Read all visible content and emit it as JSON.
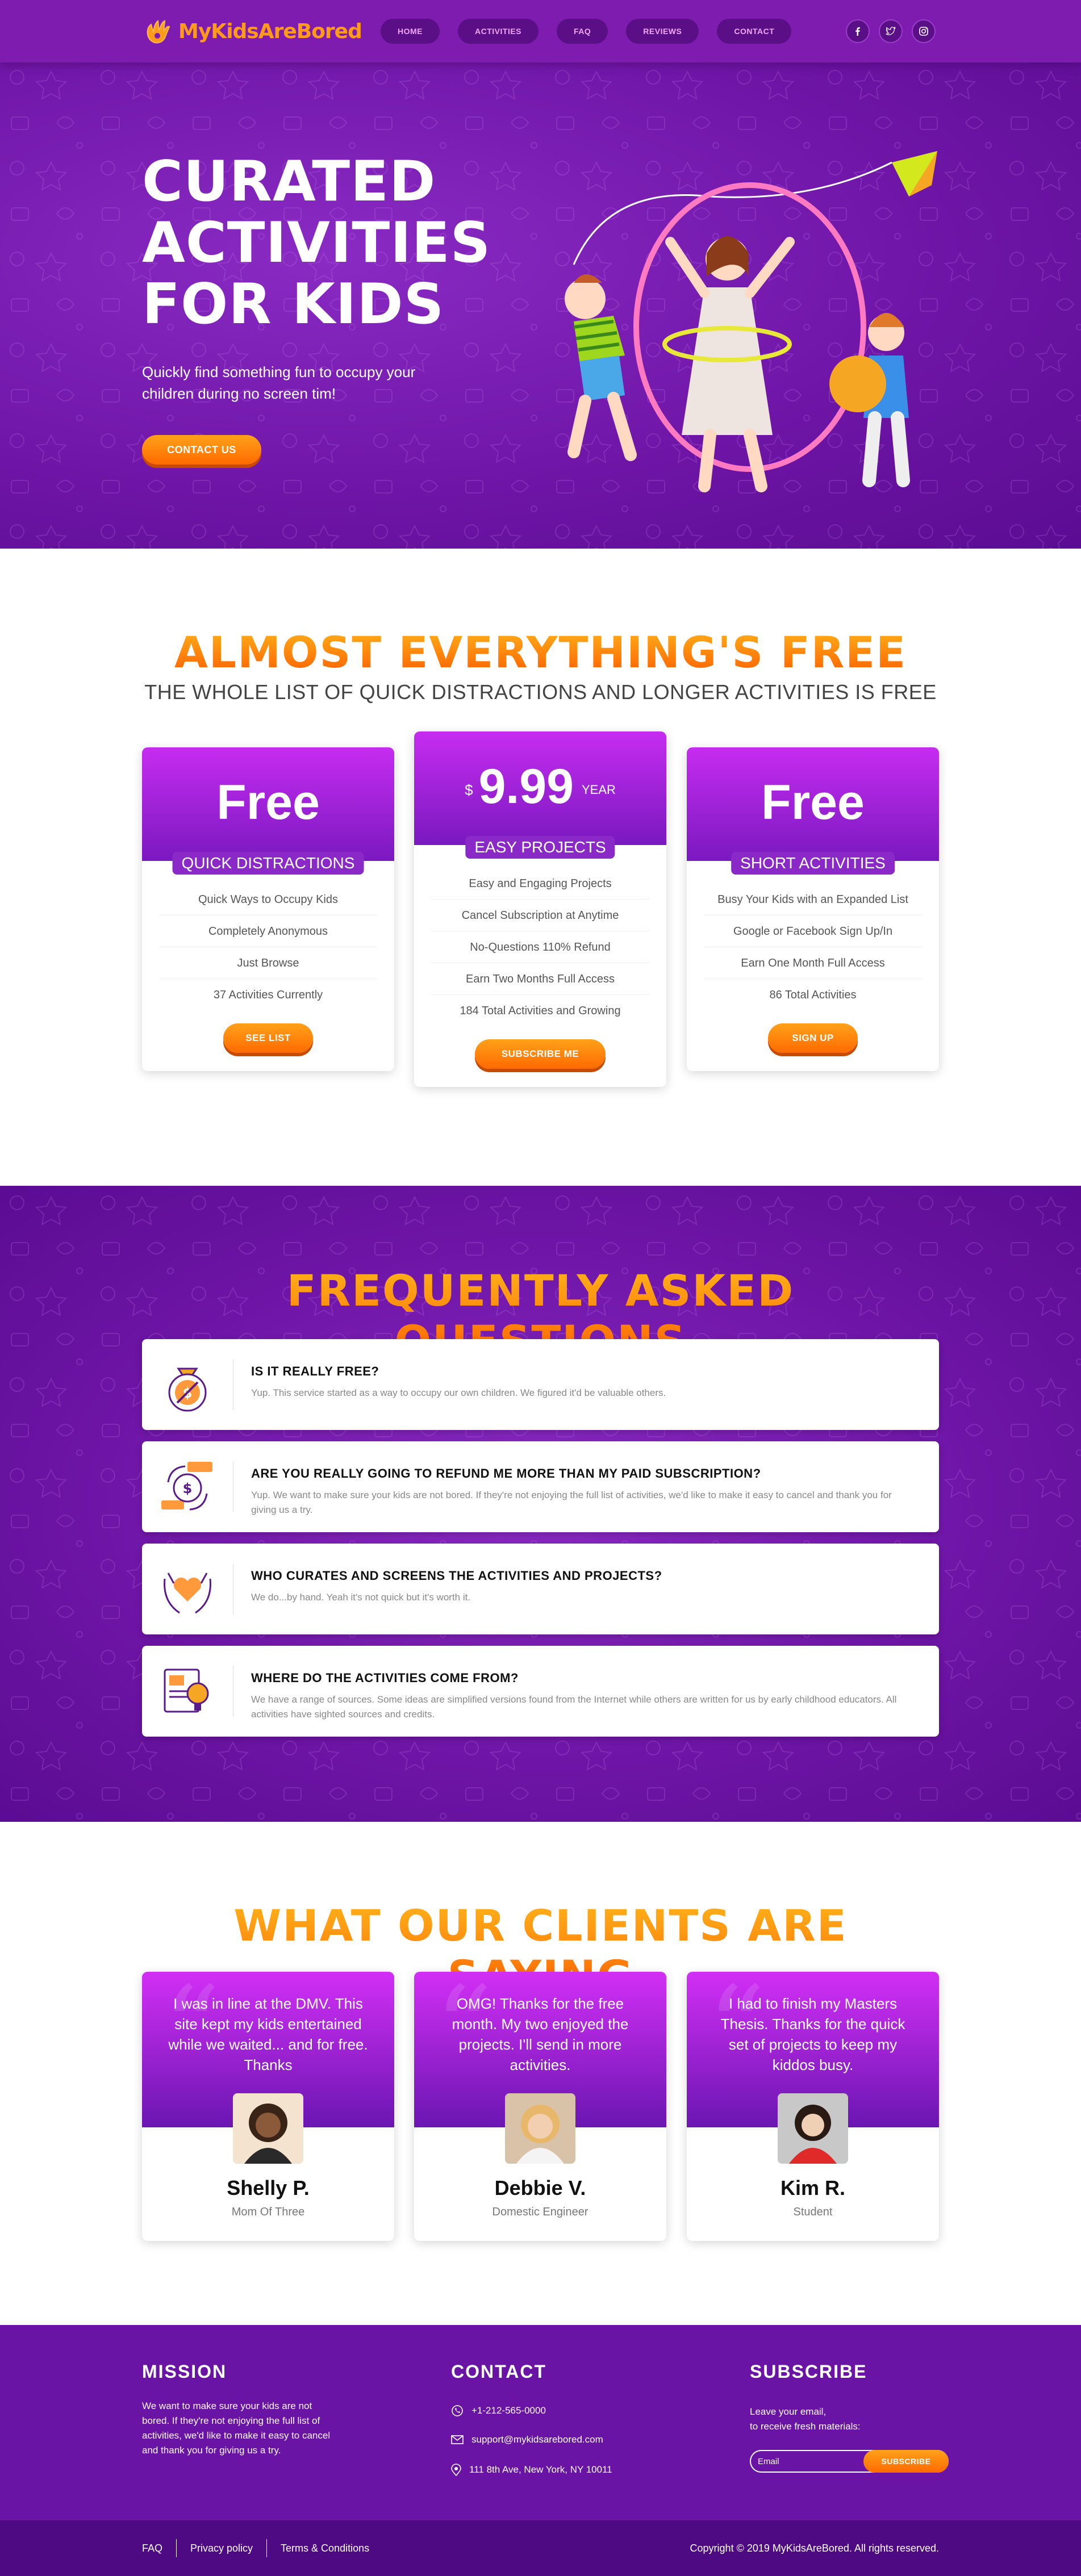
{
  "brand": {
    "name": "MyKidsAreBored"
  },
  "nav": [
    "HOME",
    "ACTIVITIES",
    "FAQ",
    "REVIEWS",
    "CONTACT"
  ],
  "socials": [
    "facebook-icon",
    "twitter-icon",
    "instagram-icon"
  ],
  "hero": {
    "title": [
      "CURATED",
      "ACTIVITIES",
      "FOR KIDS"
    ],
    "tagline": "Quickly find something fun to occupy your children during no screen tim!",
    "cta": "CONTACT US"
  },
  "pricing": {
    "title": "ALMOST EVERYTHING'S FREE",
    "subtitle": "THE WHOLE LIST OF QUICK DISTRACTIONS AND LONGER ACTIVITIES IS FREE",
    "plans": [
      {
        "price": "Free",
        "name": "QUICK DISTRACTIONS",
        "features": [
          "Quick Ways to Occupy Kids",
          "Completely Anonymous",
          "Just Browse",
          "37 Activities Currently"
        ],
        "button": "SEE LIST"
      },
      {
        "currency": "$",
        "price": "9.99",
        "period": "YEAR",
        "name": "EASY PROJECTS",
        "features": [
          "Easy and Engaging Projects",
          "Cancel Subscription at Anytime",
          "No-Questions 110% Refund",
          "Earn Two Months Full Access",
          "184 Total Activities and Growing"
        ],
        "button": "SUBSCRIBE ME"
      },
      {
        "price": "Free",
        "name": "SHORT ACTIVITIES",
        "features": [
          "Busy Your Kids with an Expanded List",
          "Google or Facebook Sign Up/In",
          "Earn One Month Full Access",
          "86 Total Activities"
        ],
        "button": "SIGN UP"
      }
    ]
  },
  "faq": {
    "title": "FREQUENTLY ASKED QUESTIONS",
    "items": [
      {
        "q": "IS IT REALLY FREE?",
        "a": "Yup. This service started as a way to occupy our own children. We figured it'd be valuable others.",
        "icon": "money-bag-icon"
      },
      {
        "q": "ARE YOU REALLY GOING TO REFUND ME MORE THAN MY PAID SUBSCRIPTION?",
        "a": "Yup. We want to make sure your kids are not bored. If they're not enjoying the full list of activities, we'd like to make it easy to cancel and thank you for giving us a try.",
        "icon": "refund-coin-icon"
      },
      {
        "q": "WHO CURATES AND SCREENS THE ACTIVITIES AND PROJECTS?",
        "a": "We do...by hand. Yeah it's not quick but it's worth it.",
        "icon": "hands-heart-icon"
      },
      {
        "q": "WHERE DO THE ACTIVITIES COME FROM?",
        "a": "We have a range of sources. Some ideas are simplified versions found from the Internet while others are written for us by early childhood educators. All activities have sighted sources and credits.",
        "icon": "document-idea-icon"
      }
    ]
  },
  "testimonials": {
    "title": "WHAT OUR CLIENTS ARE SAYING",
    "items": [
      {
        "quote": "I was in line at the DMV. This site kept my kids entertained while we waited... and for free. Thanks",
        "name": "Shelly P.",
        "role": "Mom Of Three"
      },
      {
        "quote": "OMG! Thanks for the free month. My two enjoyed the projects. I'll send in more activities.",
        "name": "Debbie V.",
        "role": "Domestic Engineer"
      },
      {
        "quote": "I had to finish my Masters Thesis. Thanks for the quick set of projects to keep my kiddos busy.",
        "name": "Kim R.",
        "role": "Student"
      }
    ]
  },
  "footer": {
    "mission_title": "MISSION",
    "mission_text": "We want to make sure your kids are not bored. If they're not enjoying the full list of activities, we'd like to make it easy to cancel and thank you for giving us a try.",
    "contact_title": "CONTACT",
    "phone": "+1-212-565-0000",
    "email": "support@mykidsarebored.com",
    "address": "111 8th Ave, New York, NY 10011",
    "subscribe_title": "SUBSCRIBE",
    "subscribe_text": [
      "Leave your email,",
      "to receive fresh materials:"
    ],
    "email_placeholder": "Email",
    "subscribe_button": "SUBSCRIBE",
    "links": [
      "FAQ",
      "Privacy policy",
      "Terms & Conditions"
    ],
    "copyright": "Copyright © 2019 MyKidsAreBored. All rights reserved."
  },
  "colors": {
    "purple": "#7e1cb0",
    "orange": "#ff8a14"
  }
}
